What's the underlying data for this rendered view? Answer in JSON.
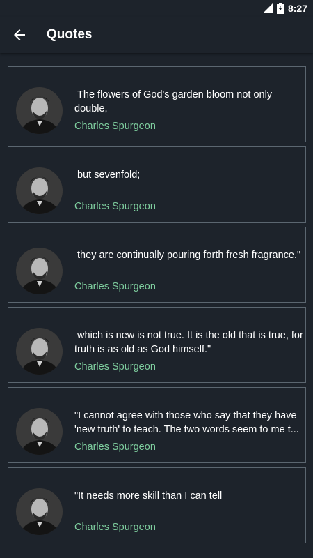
{
  "status_bar": {
    "time": "8:27"
  },
  "app_bar": {
    "title": "Quotes"
  },
  "quotes": [
    {
      "text": " The flowers of God's garden bloom not only double,",
      "author": "Charles Spurgeon"
    },
    {
      "text": " but sevenfold;",
      "author": "Charles Spurgeon"
    },
    {
      "text": " they are continually pouring forth fresh fragrance.\"",
      "author": "Charles Spurgeon"
    },
    {
      "text": " which is new is not true. It is the old that is true, for truth is as old as God himself.\"",
      "author": "Charles Spurgeon"
    },
    {
      "text": "\"I cannot agree with those who say that they have 'new truth' to teach. The two words seem to me t...",
      "author": "Charles Spurgeon"
    },
    {
      "text": "\"It needs more skill than I can tell",
      "author": "Charles Spurgeon"
    }
  ]
}
